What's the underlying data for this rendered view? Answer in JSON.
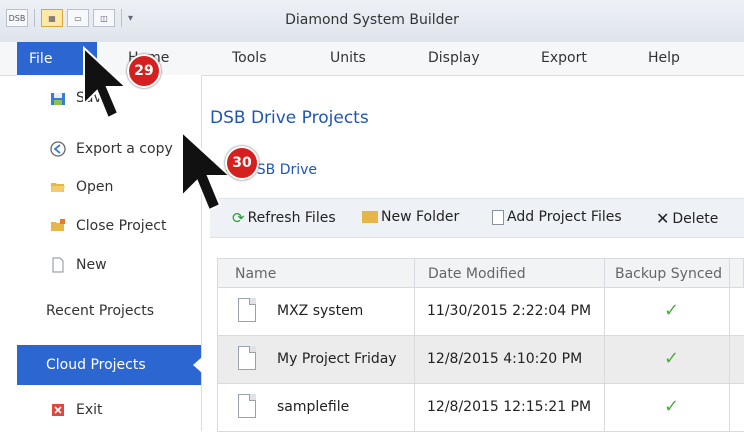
{
  "window": {
    "title": "Diamond System Builder",
    "qat_logo": "DSB"
  },
  "menu": {
    "file": "File",
    "home": "Home",
    "tools": "Tools",
    "units": "Units",
    "display": "Display",
    "export": "Export",
    "help": "Help"
  },
  "sidebar": {
    "save": "Save",
    "export_copy": "Export a copy",
    "open": "Open",
    "close_project": "Close Project",
    "new": "New",
    "recent_projects": "Recent Projects",
    "cloud_projects": "Cloud Projects",
    "exit": "Exit"
  },
  "main": {
    "title": "DSB Drive Projects",
    "breadcrumb": "DSB Drive",
    "toolbar": {
      "refresh": "Refresh Files",
      "new_folder": "New Folder",
      "add_files": "Add Project Files",
      "delete": "Delete"
    },
    "columns": {
      "name": "Name",
      "date": "Date Modified",
      "backup": "Backup Synced"
    },
    "rows": [
      {
        "name": "MXZ system",
        "date": "11/30/2015 2:22:04 PM",
        "synced": "✓"
      },
      {
        "name": "My Project Friday",
        "date": "12/8/2015 4:10:20 PM",
        "synced": "✓"
      },
      {
        "name": "samplefile",
        "date": "12/8/2015 12:15:21 PM",
        "synced": "✓"
      }
    ]
  },
  "annotations": {
    "badge_29": "29",
    "badge_30": "30"
  },
  "colors": {
    "accent": "#2c66d0",
    "title_blue": "#1f55b4",
    "badge": "#d6201f",
    "check": "#4caf3c"
  }
}
